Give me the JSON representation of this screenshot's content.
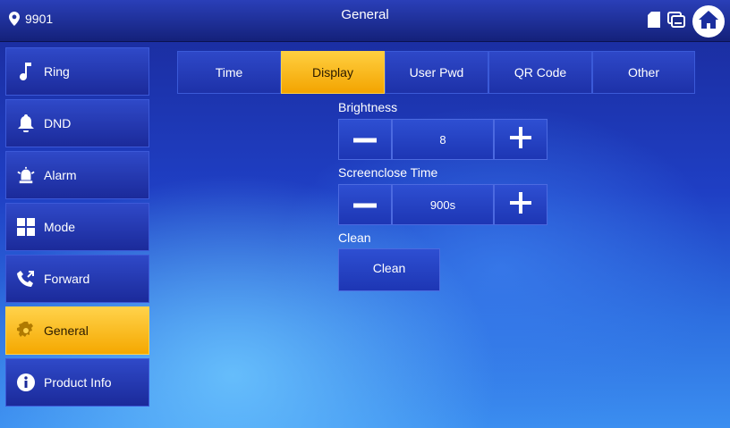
{
  "header": {
    "location": "9901",
    "title": "General",
    "icons": [
      "location-pin-icon",
      "sd-card-icon",
      "monitor-icon",
      "home-icon"
    ]
  },
  "sidebar": {
    "items": [
      {
        "label": "Ring",
        "icon": "music-note-icon",
        "active": false
      },
      {
        "label": "DND",
        "icon": "bell-icon",
        "active": false
      },
      {
        "label": "Alarm",
        "icon": "alarm-siren-icon",
        "active": false
      },
      {
        "label": "Mode",
        "icon": "grid-icon",
        "active": false
      },
      {
        "label": "Forward",
        "icon": "phone-forward-icon",
        "active": false
      },
      {
        "label": "General",
        "icon": "gear-icon",
        "active": true
      },
      {
        "label": "Product Info",
        "icon": "info-icon",
        "active": false
      }
    ]
  },
  "tabs": [
    {
      "label": "Time",
      "active": false
    },
    {
      "label": "Display",
      "active": true
    },
    {
      "label": "User Pwd",
      "active": false
    },
    {
      "label": "QR Code",
      "active": false
    },
    {
      "label": "Other",
      "active": false
    }
  ],
  "settings": {
    "brightness": {
      "label": "Brightness",
      "value": "8"
    },
    "screenclose": {
      "label": "Screenclose Time",
      "value": "900s"
    },
    "clean": {
      "label": "Clean",
      "button": "Clean"
    }
  },
  "colors": {
    "accent": "#f5a800",
    "panel": "#1d31a8"
  }
}
